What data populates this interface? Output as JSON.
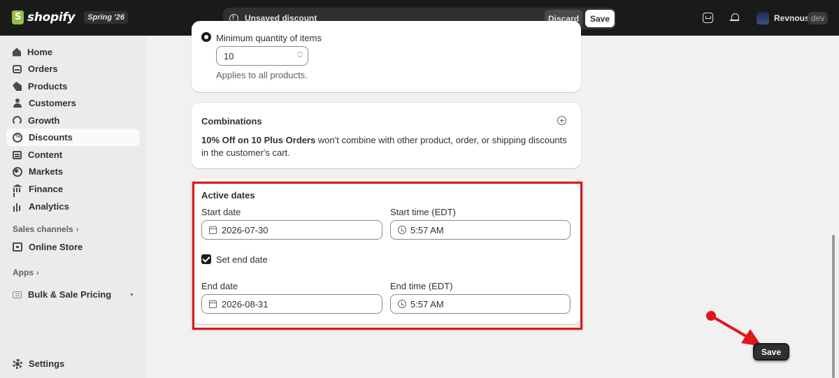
{
  "topbar": {
    "brand": "shopify",
    "edition_badge": "Spring '26",
    "savebar_text": "Unsaved discount",
    "discard_label": "Discard",
    "save_label": "Save",
    "store_name": "Revnous",
    "store_badge": "dev"
  },
  "sidebar": {
    "items": [
      {
        "label": "Home",
        "icon": "home-icon"
      },
      {
        "label": "Orders",
        "icon": "orders-icon"
      },
      {
        "label": "Products",
        "icon": "tag-icon"
      },
      {
        "label": "Customers",
        "icon": "person-icon"
      },
      {
        "label": "Growth",
        "icon": "growth-icon"
      },
      {
        "label": "Discounts",
        "icon": "discount-icon",
        "active": true
      },
      {
        "label": "Content",
        "icon": "content-icon"
      },
      {
        "label": "Markets",
        "icon": "globe-icon"
      },
      {
        "label": "Finance",
        "icon": "bank-icon"
      },
      {
        "label": "Analytics",
        "icon": "bar-chart-icon"
      }
    ],
    "sales_channels_label": "Sales channels",
    "online_store_label": "Online Store",
    "apps_label": "Apps",
    "app_item_label": "Bulk & Sale Pricing",
    "settings_label": "Settings"
  },
  "minimum": {
    "radio_label": "Minimum quantity of items",
    "quantity_value": "10",
    "helper": "Applies to all products."
  },
  "combinations": {
    "title": "Combinations",
    "discount_name": "10% Off on 10 Plus Orders",
    "description": " won't combine with other product, order, or shipping discounts in the customer's cart."
  },
  "active_dates": {
    "title": "Active dates",
    "start_date_label": "Start date",
    "start_date_value": "2026-07-30",
    "start_time_label": "Start time (EDT)",
    "start_time_value": "5:57 AM",
    "set_end_date_label": "Set end date",
    "set_end_date_checked": true,
    "end_date_label": "End date",
    "end_date_value": "2026-08-31",
    "end_time_label": "End time (EDT)",
    "end_time_value": "5:57 AM"
  },
  "floating_save_label": "Save",
  "colors": {
    "topbar": "#1a1a1a",
    "highlight": "#d41c1c",
    "arrow": "#e0181b",
    "logo_green": "#95bf47"
  }
}
